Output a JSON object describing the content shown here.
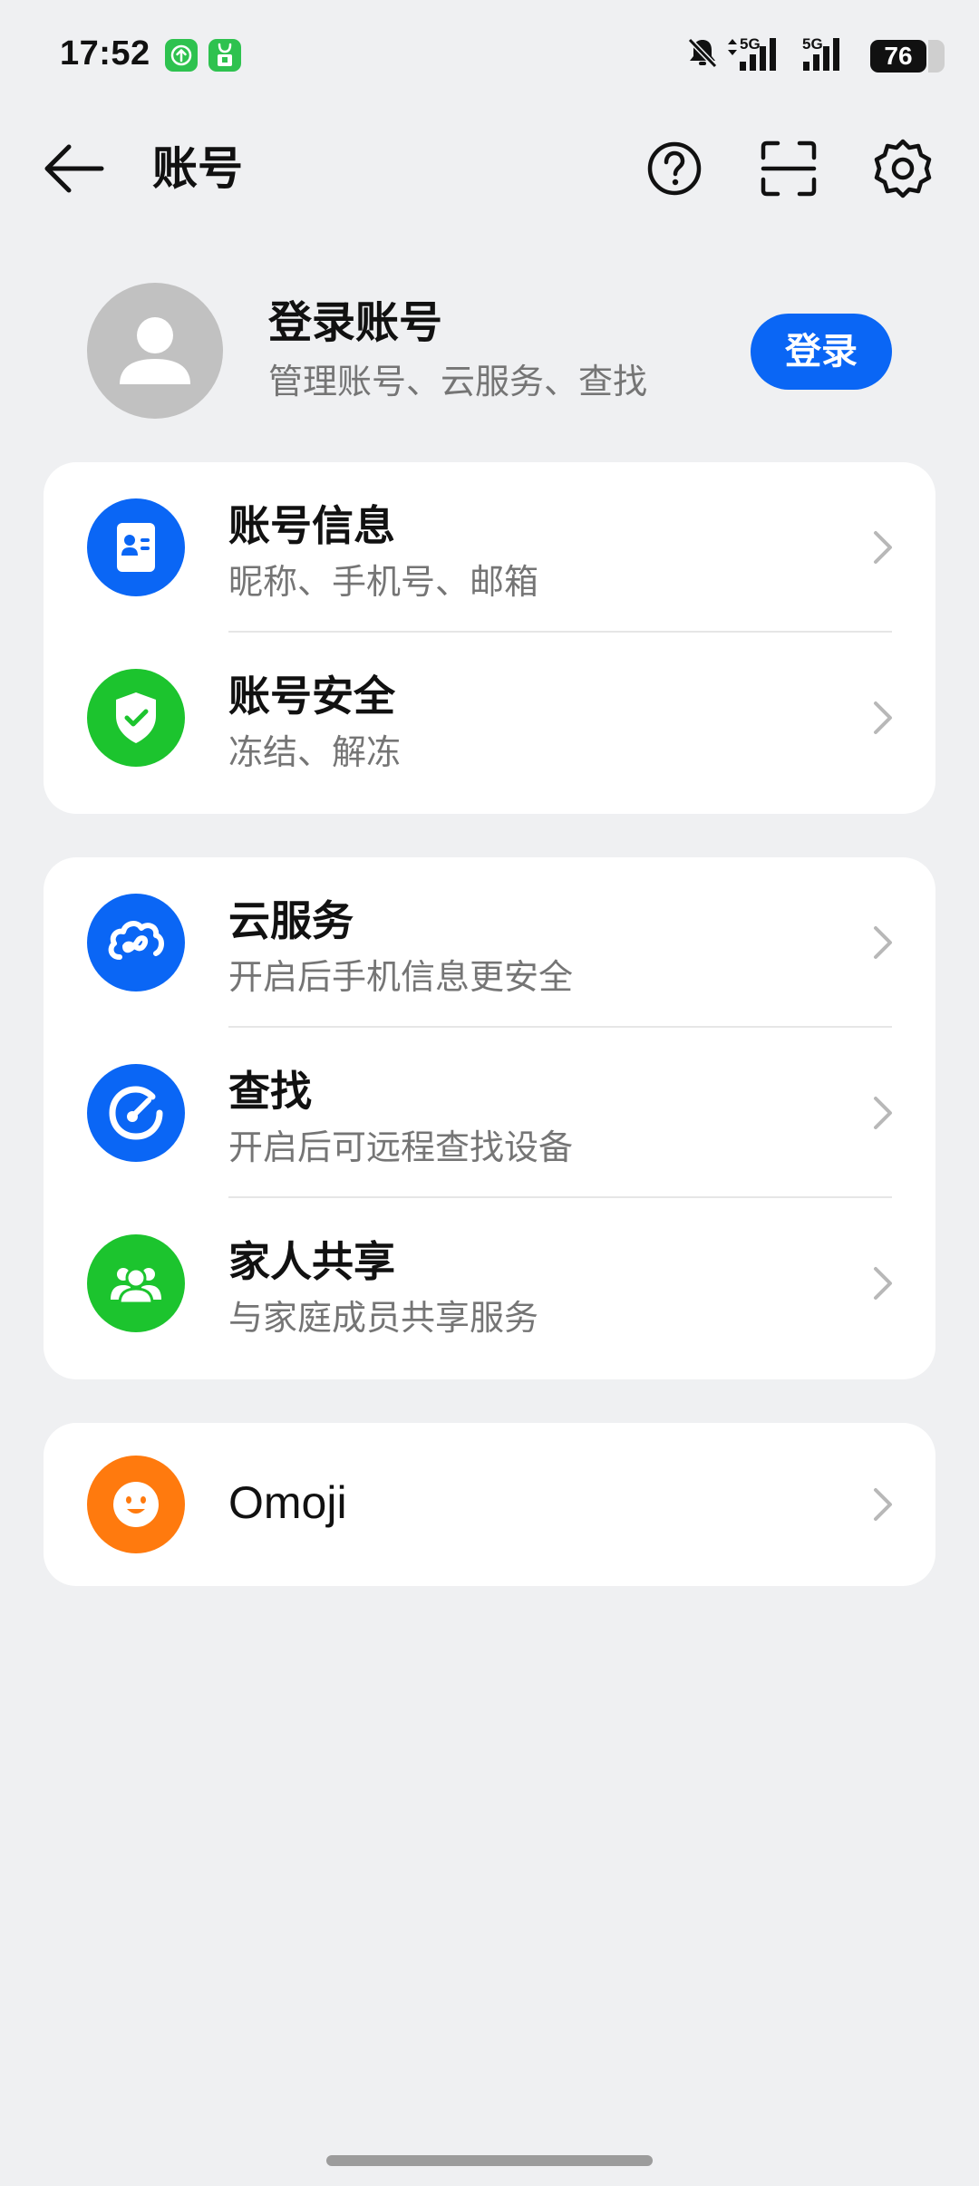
{
  "status_bar": {
    "time": "17:52",
    "network_1": "5G",
    "network_2": "5G",
    "battery": "76"
  },
  "header": {
    "title": "账号",
    "icons": [
      "back-arrow-icon",
      "help-icon",
      "scan-icon",
      "gear-icon"
    ]
  },
  "account": {
    "title": "登录账号",
    "subtitle": "管理账号、云服务、查找",
    "login_label": "登录"
  },
  "groups": [
    {
      "items": [
        {
          "title": "账号信息",
          "subtitle": "昵称、手机号、邮箱",
          "icon": "contact-card-icon",
          "color": "#0a66f5"
        },
        {
          "title": "账号安全",
          "subtitle": "冻结、解冻",
          "icon": "shield-check-icon",
          "color": "#1cc42e"
        }
      ]
    },
    {
      "items": [
        {
          "title": "云服务",
          "subtitle": "开启后手机信息更安全",
          "icon": "cloud-icon",
          "color": "#0a66f5"
        },
        {
          "title": "查找",
          "subtitle": "开启后可远程查找设备",
          "icon": "find-device-icon",
          "color": "#0a66f5"
        },
        {
          "title": "家人共享",
          "subtitle": "与家庭成员共享服务",
          "icon": "family-icon",
          "color": "#1cc42e"
        }
      ]
    },
    {
      "items": [
        {
          "title": "Omoji",
          "icon": "smiley-icon",
          "color": "#ff7a0e"
        }
      ]
    }
  ]
}
